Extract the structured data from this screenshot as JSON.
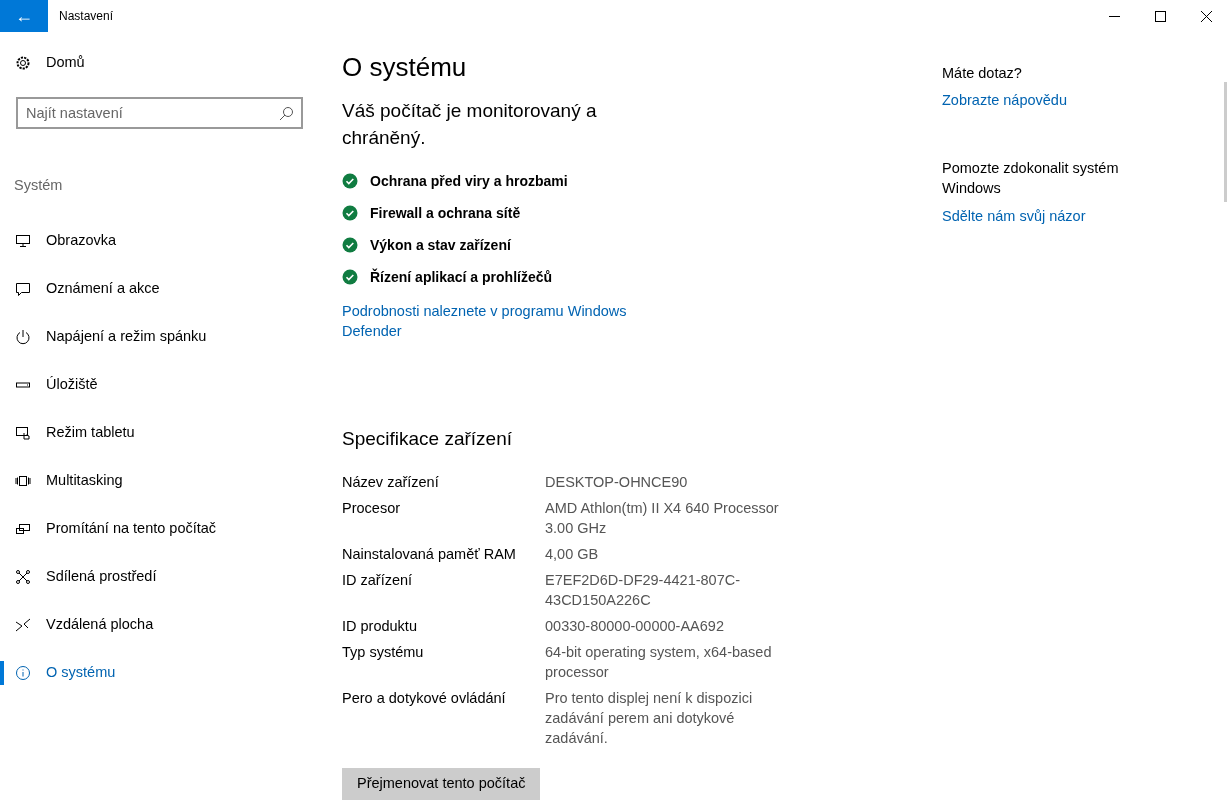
{
  "window": {
    "title": "Nastavení",
    "back_button": "←"
  },
  "sidebar": {
    "home": "Domů",
    "search": {
      "placeholder": "Najít nastavení"
    },
    "section": "Systém",
    "items": [
      {
        "label": "Obrazovka",
        "selected": false
      },
      {
        "label": "Oznámení a akce",
        "selected": false
      },
      {
        "label": "Napájení a režim spánku",
        "selected": false
      },
      {
        "label": "Úložiště",
        "selected": false
      },
      {
        "label": "Režim tabletu",
        "selected": false
      },
      {
        "label": "Multitasking",
        "selected": false
      },
      {
        "label": "Promítání na tento počítač",
        "selected": false
      },
      {
        "label": "Sdílená prostředí",
        "selected": false
      },
      {
        "label": "Vzdálená plocha",
        "selected": false
      },
      {
        "label": "O systému",
        "selected": true
      }
    ]
  },
  "page": {
    "title": "O systému",
    "protection_heading": "Váš počítač je monitorovaný a chráněný.",
    "protection_items": [
      {
        "label": "Ochrana před viry a hrozbami",
        "checked": true
      },
      {
        "label": "Firewall a ochrana sítě",
        "checked": true
      },
      {
        "label": "Výkon a stav zařízení",
        "checked": true
      },
      {
        "label": "Řízení aplikací a prohlížečů",
        "checked": true
      }
    ],
    "defender_link": "Podrobnosti naleznete v programu Windows Defender",
    "specs_heading": "Specifikace zařízení",
    "specs": [
      {
        "label": "Název zařízení",
        "value": "DESKTOP-OHNCE90"
      },
      {
        "label": "Procesor",
        "value": "AMD Athlon(tm) II X4 640 Processor 3.00 GHz"
      },
      {
        "label": "Nainstalovaná paměť RAM",
        "value": "4,00 GB"
      },
      {
        "label": "ID zařízení",
        "value": "E7EF2D6D-DF29-4421-807C-43CD150A226C"
      },
      {
        "label": "ID produktu",
        "value": "00330-80000-00000-AA692"
      },
      {
        "label": "Typ systému",
        "value": "64-bit operating system, x64-based processor"
      },
      {
        "label": "Pero a dotykové ovládání",
        "value": "Pro tento displej není k dispozici zadávání perem ani dotykové zadávání."
      }
    ],
    "rename_button": "Přejmenovat tento počítač"
  },
  "aside": {
    "question": "Máte dotaz?",
    "help_link": "Zobrazte nápovědu",
    "improve": "Pomozte zdokonalit systém Windows",
    "feedback_link": "Sdělte nám svůj názor"
  }
}
